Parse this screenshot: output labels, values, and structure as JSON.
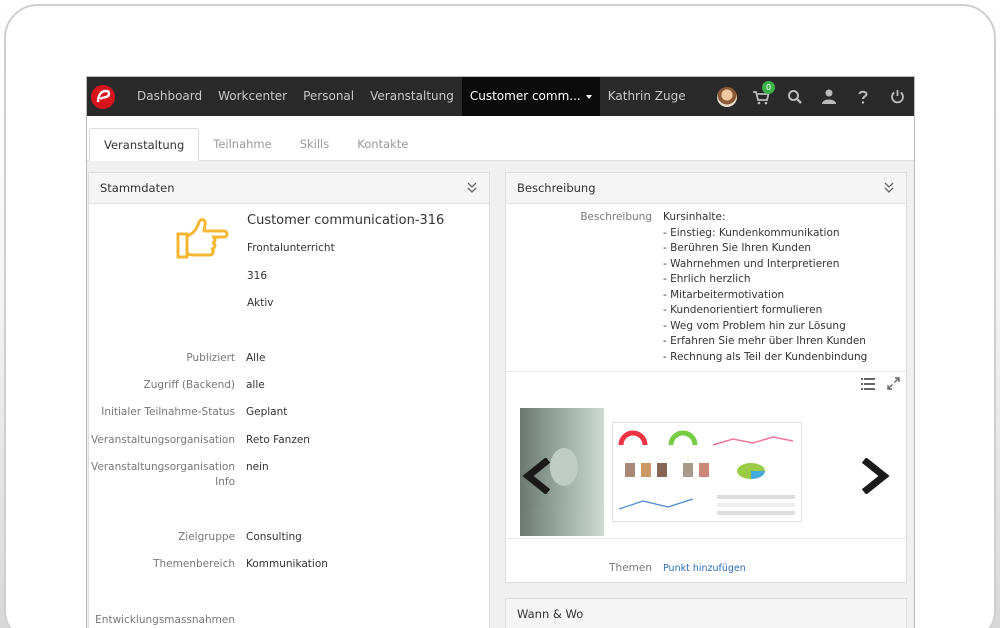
{
  "nav": {
    "items": [
      "Dashboard",
      "Workcenter",
      "Personal",
      "Veranstaltung"
    ],
    "active_item": "Customer comm...",
    "user_name": "Kathrin Zuge",
    "cart_count": "0",
    "icons": [
      "avatar",
      "cart-icon",
      "search-icon",
      "user-icon",
      "help-icon",
      "power-icon"
    ]
  },
  "tabs": [
    "Veranstaltung",
    "Teilnahme",
    "Skills",
    "Kontakte"
  ],
  "stammdaten": {
    "heading": "Stammdaten",
    "title": "Customer communication-316",
    "type": "Frontalunterricht",
    "number": "316",
    "status": "Aktiv",
    "fields": [
      {
        "label": "Publiziert",
        "value": "Alle"
      },
      {
        "label": "Zugriff (Backend)",
        "value": "alle"
      },
      {
        "label": "Initialer Teilnahme-Status",
        "value": "Geplant"
      },
      {
        "label": "Veranstaltungsorganisation",
        "value": "Reto Fanzen"
      },
      {
        "label": "Veranstaltungsorganisation Info",
        "value": "nein"
      },
      {
        "label": "Zielgruppe",
        "value": "Consulting"
      },
      {
        "label": "Themenbereich",
        "value": "Kommunikation"
      },
      {
        "label": "Entwicklungsmassnahmen",
        "value": ""
      }
    ]
  },
  "beschreibung": {
    "heading": "Beschreibung",
    "label": "Beschreibung",
    "lines": [
      "Kursinhalte:",
      "- Einstieg: Kundenkommunikation",
      "- Berühren Sie Ihren Kunden",
      "- Wahrnehmen und Interpretieren",
      "- Ehrlich herzlich",
      "- Mitarbeitermotivation",
      "- Kundenorientiert formulieren",
      "- Weg vom Problem hin zur Lösung",
      "- Erfahren Sie mehr über Ihren Kunden",
      "- Rechnung als Teil der Kundenbindung"
    ],
    "themen_label": "Themen",
    "add_link": "Punkt hinzufügen"
  },
  "wann_wo": {
    "heading": "Wann & Wo"
  },
  "colors": {
    "nav_bg": "#2a2a2a",
    "accent": "#d7141d",
    "hand": "#f5b731",
    "link": "#2a6ebb"
  }
}
